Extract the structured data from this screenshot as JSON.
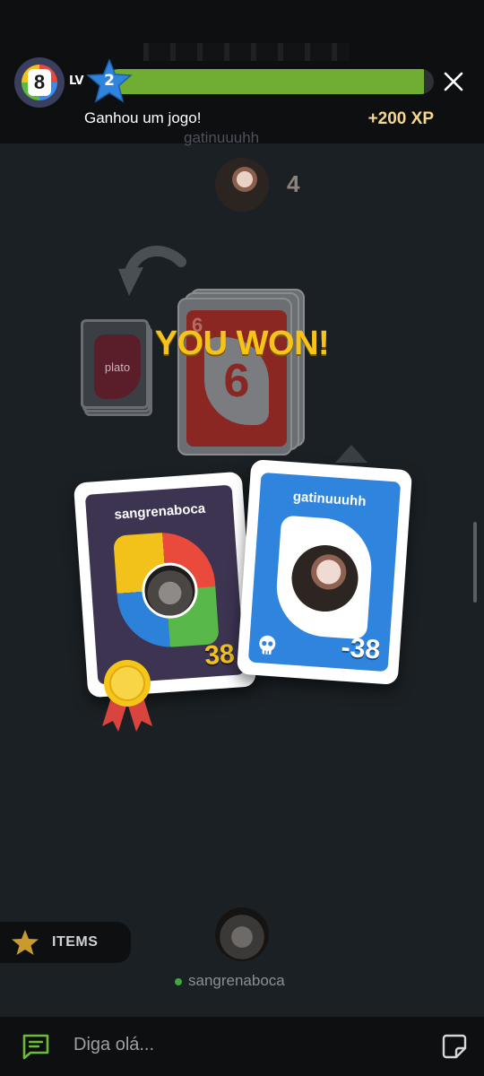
{
  "header": {
    "game_logo_number": "8",
    "level_label": "LV",
    "level_value": "2",
    "xp_progress": 0.97,
    "notification_text": "Ganhou um jogo!",
    "xp_gain": "+200 XP",
    "close_icon": "close-icon"
  },
  "opponent": {
    "name": "gatinuuuhh",
    "card_count": "4"
  },
  "board": {
    "deck_logo": "plato",
    "pile_top_card": "6",
    "pile_color": "#8a2723",
    "result_banner": "YOU WON!"
  },
  "results": {
    "winner": {
      "name": "sangrenaboca",
      "score": "38",
      "badge": "medal-icon"
    },
    "loser": {
      "name": "gatinuuuhh",
      "score": "-38",
      "badge": "skull-icon"
    }
  },
  "items": {
    "label": "ITEMS",
    "icon": "star-icon"
  },
  "me": {
    "name": "sangrenaboca",
    "status": "online"
  },
  "chat": {
    "placeholder": "Diga olá...",
    "chat_icon": "chat-icon",
    "sticker_icon": "sticker-icon"
  },
  "colors": {
    "accent_yellow": "#f7c318",
    "xp_green": "#6fae32",
    "level_blue": "#2f85de",
    "background": "#1b2024"
  }
}
